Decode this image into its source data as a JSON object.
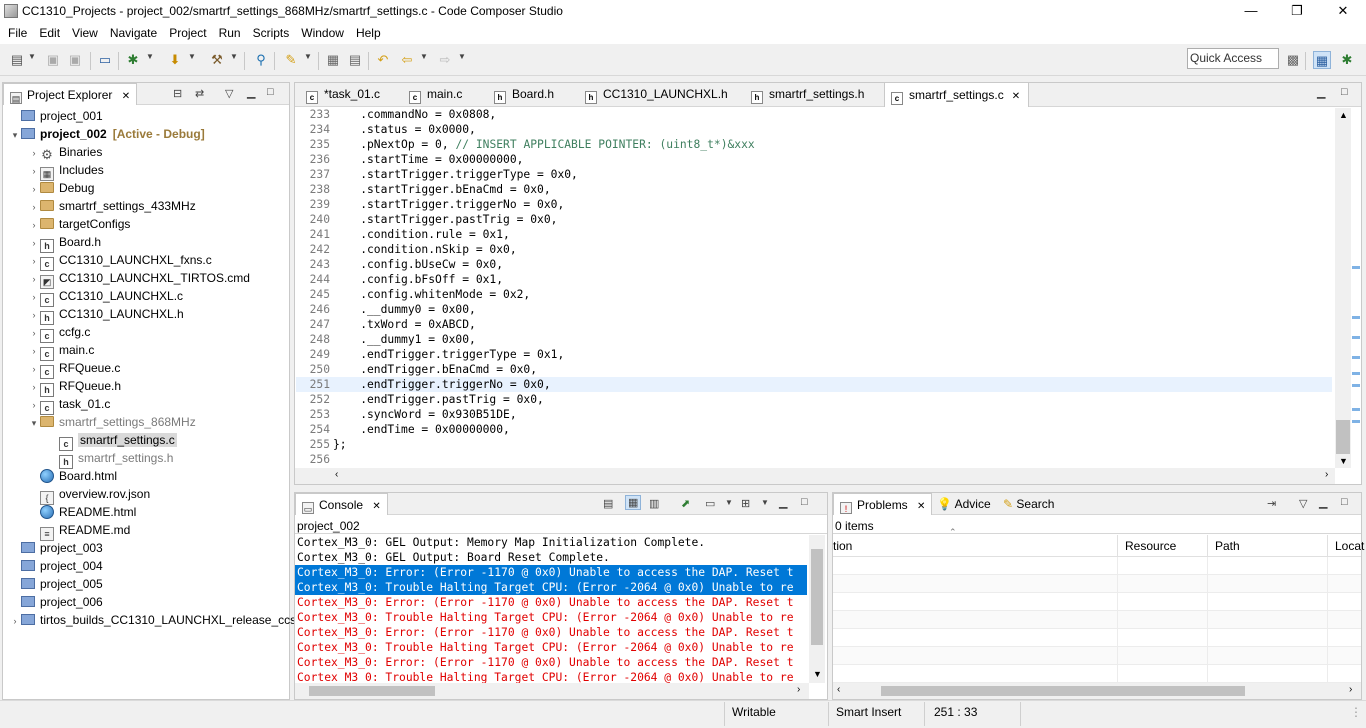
{
  "window": {
    "title": "CC1310_Projects - project_002/smartrf_settings_868MHz/smartrf_settings.c - Code Composer Studio",
    "minimize": "—",
    "maximize": "❐",
    "close": "✕"
  },
  "menu": [
    "File",
    "Edit",
    "View",
    "Navigate",
    "Project",
    "Run",
    "Scripts",
    "Window",
    "Help"
  ],
  "quick_access": "Quick Access",
  "project_explorer": {
    "tab_label": "Project Explorer",
    "items": [
      {
        "label": "project_001",
        "icon": "project-folder-icon",
        "twisty": "",
        "bold": false
      },
      {
        "label": "project_002",
        "icon": "project-folder-icon",
        "twisty": "▾",
        "bold": true,
        "suffix": "[Active - Debug]"
      },
      {
        "label": "Binaries",
        "icon": "binaries-gear-icon",
        "twisty": "›"
      },
      {
        "label": "Includes",
        "icon": "includes-icon",
        "twisty": "›"
      },
      {
        "label": "Debug",
        "icon": "folder-icon",
        "twisty": "›"
      },
      {
        "label": "smartrf_settings_433MHz",
        "icon": "folder-icon",
        "twisty": "›"
      },
      {
        "label": "targetConfigs",
        "icon": "folder-icon",
        "twisty": "›"
      },
      {
        "label": "Board.h",
        "icon": "header-file-icon",
        "twisty": "›"
      },
      {
        "label": "CC1310_LAUNCHXL_fxns.c",
        "icon": "c-file-icon",
        "twisty": "›"
      },
      {
        "label": "CC1310_LAUNCHXL_TIRTOS.cmd",
        "icon": "cmd-file-icon",
        "twisty": "›"
      },
      {
        "label": "CC1310_LAUNCHXL.c",
        "icon": "c-file-icon",
        "twisty": "›"
      },
      {
        "label": "CC1310_LAUNCHXL.h",
        "icon": "header-file-icon",
        "twisty": "›"
      },
      {
        "label": "ccfg.c",
        "icon": "c-file-icon",
        "twisty": "›"
      },
      {
        "label": "main.c",
        "icon": "c-file-icon",
        "twisty": "›"
      },
      {
        "label": "RFQueue.c",
        "icon": "c-file-icon",
        "twisty": "›"
      },
      {
        "label": "RFQueue.h",
        "icon": "header-file-icon",
        "twisty": "›"
      },
      {
        "label": "task_01.c",
        "icon": "c-file-icon",
        "twisty": "›"
      },
      {
        "label": "smartrf_settings_868MHz",
        "icon": "folder-icon",
        "twisty": "▾",
        "dim": true
      },
      {
        "label": "smartrf_settings.c",
        "icon": "c-file-icon",
        "twisty": "",
        "selected": true
      },
      {
        "label": "smartrf_settings.h",
        "icon": "header-file-icon",
        "twisty": "",
        "dim": true
      },
      {
        "label": "Board.html",
        "icon": "globe-icon",
        "twisty": ""
      },
      {
        "label": "overview.rov.json",
        "icon": "json-file-icon",
        "twisty": ""
      },
      {
        "label": "README.html",
        "icon": "globe-icon",
        "twisty": ""
      },
      {
        "label": "README.md",
        "icon": "text-file-icon",
        "twisty": ""
      },
      {
        "label": "project_003",
        "icon": "project-folder-icon",
        "twisty": ""
      },
      {
        "label": "project_004",
        "icon": "project-folder-icon",
        "twisty": ""
      },
      {
        "label": "project_005",
        "icon": "project-folder-icon",
        "twisty": ""
      },
      {
        "label": "project_006",
        "icon": "project-folder-icon",
        "twisty": ""
      },
      {
        "label": "tirtos_builds_CC1310_LAUNCHXL_release_ccs",
        "icon": "rtsc-project-icon",
        "twisty": "›"
      }
    ]
  },
  "editor": {
    "tabs": [
      {
        "label": "*task_01.c",
        "type": "c"
      },
      {
        "label": "main.c",
        "type": "c"
      },
      {
        "label": "Board.h",
        "type": "h"
      },
      {
        "label": "CC1310_LAUNCHXL.h",
        "type": "h"
      },
      {
        "label": "smartrf_settings.h",
        "type": "h"
      },
      {
        "label": "smartrf_settings.c",
        "type": "c",
        "active": true
      }
    ],
    "current_line": "251",
    "lines": [
      {
        "n": "233",
        "code": "    .commandNo = 0x0808,"
      },
      {
        "n": "234",
        "code": "    .status = 0x0000,"
      },
      {
        "n": "235",
        "code": "    .pNextOp = 0, ",
        "comment": "// INSERT APPLICABLE POINTER: (uint8_t*)&xxx"
      },
      {
        "n": "236",
        "code": "    .startTime = 0x00000000,"
      },
      {
        "n": "237",
        "code": "    .startTrigger.triggerType = 0x0,"
      },
      {
        "n": "238",
        "code": "    .startTrigger.bEnaCmd = 0x0,"
      },
      {
        "n": "239",
        "code": "    .startTrigger.triggerNo = 0x0,"
      },
      {
        "n": "240",
        "code": "    .startTrigger.pastTrig = 0x0,"
      },
      {
        "n": "241",
        "code": "    .condition.rule = 0x1,"
      },
      {
        "n": "242",
        "code": "    .condition.nSkip = 0x0,"
      },
      {
        "n": "243",
        "code": "    .config.bUseCw = 0x0,"
      },
      {
        "n": "244",
        "code": "    .config.bFsOff = 0x1,"
      },
      {
        "n": "245",
        "code": "    .config.whitenMode = 0x2,"
      },
      {
        "n": "246",
        "code": "    .__dummy0 = 0x00,"
      },
      {
        "n": "247",
        "code": "    .txWord = 0xABCD,"
      },
      {
        "n": "248",
        "code": "    .__dummy1 = 0x00,"
      },
      {
        "n": "249",
        "code": "    .endTrigger.triggerType = 0x1,"
      },
      {
        "n": "250",
        "code": "    .endTrigger.bEnaCmd = 0x0,"
      },
      {
        "n": "251",
        "code": "    .endTrigger.triggerNo = 0x0,"
      },
      {
        "n": "252",
        "code": "    .endTrigger.pastTrig = 0x0,"
      },
      {
        "n": "253",
        "code": "    .syncWord = 0x930B51DE,"
      },
      {
        "n": "254",
        "code": "    .endTime = 0x00000000,"
      },
      {
        "n": "255",
        "code": "};"
      },
      {
        "n": "256",
        "code": ""
      }
    ]
  },
  "console": {
    "tab_label": "Console",
    "project": "project_002",
    "lines": [
      {
        "text": "Cortex_M3_0: GEL Output: Memory Map Initialization Complete.",
        "style": "normal"
      },
      {
        "text": "Cortex_M3_0: GEL Output: Board Reset Complete.",
        "style": "normal"
      },
      {
        "text": "Cortex_M3_0: Error: (Error -1170 @ 0x0) Unable to access the DAP. Reset t",
        "style": "sel"
      },
      {
        "text": "Cortex_M3_0: Trouble Halting Target CPU: (Error -2064 @ 0x0) Unable to re",
        "style": "sel"
      },
      {
        "text": "Cortex_M3_0: Error: (Error -1170 @ 0x0) Unable to access the DAP. Reset t",
        "style": "err"
      },
      {
        "text": "Cortex_M3_0: Trouble Halting Target CPU: (Error -2064 @ 0x0) Unable to re",
        "style": "err"
      },
      {
        "text": "Cortex_M3_0: Error: (Error -1170 @ 0x0) Unable to access the DAP. Reset t",
        "style": "err"
      },
      {
        "text": "Cortex_M3_0: Trouble Halting Target CPU: (Error -2064 @ 0x0) Unable to re",
        "style": "err"
      },
      {
        "text": "Cortex_M3_0: Error: (Error -1170 @ 0x0) Unable to access the DAP. Reset t",
        "style": "err"
      },
      {
        "text": "Cortex_M3_0: Trouble Halting Target CPU: (Error -2064 @ 0x0) Unable to re",
        "style": "err"
      }
    ]
  },
  "problems": {
    "tabs": [
      "Problems",
      "Advice",
      "Search"
    ],
    "count": "0 items",
    "columns": [
      "tion",
      "Resource",
      "Path",
      "Locat"
    ]
  },
  "status": {
    "writable": "Writable",
    "insert_mode": "Smart Insert",
    "position": "251 : 33"
  }
}
